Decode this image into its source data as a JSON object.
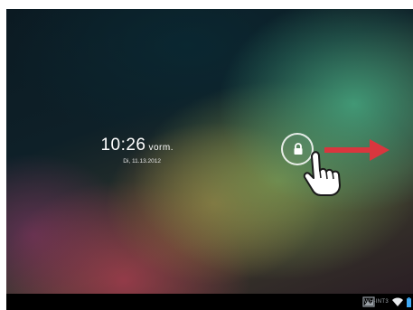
{
  "lockscreen": {
    "time": "10:26",
    "ampm": "vorm.",
    "date": "Di, 11.13.2012"
  },
  "status_bar": {
    "wifi_name": "WH-INT3",
    "icons": [
      "image-icon",
      "wifi-icon",
      "battery-icon"
    ]
  },
  "overlay": {
    "arrow_color": "#d9363e",
    "lock_icon": "lock-icon",
    "hand_icon": "pointing-hand-icon"
  }
}
